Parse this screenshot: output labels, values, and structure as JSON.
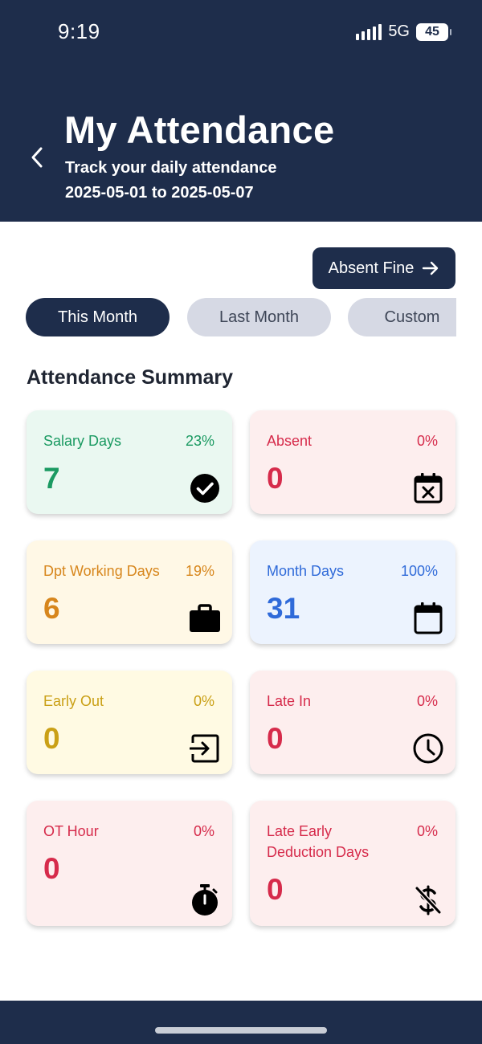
{
  "status_bar": {
    "time": "9:19",
    "network": "5G",
    "battery": "45"
  },
  "header": {
    "title": "My Attendance",
    "subtitle": "Track your daily attendance",
    "date_range": "2025-05-01 to 2025-05-07"
  },
  "actions": {
    "absent_fine": "Absent Fine"
  },
  "tabs": [
    {
      "label": "This Month",
      "active": true
    },
    {
      "label": "Last Month",
      "active": false
    },
    {
      "label": "Custom",
      "active": false
    }
  ],
  "summary": {
    "title": "Attendance Summary",
    "cards": [
      {
        "label": "Salary Days",
        "value": "7",
        "percent": "23%",
        "icon": "check-circle-icon",
        "bg": "#eaf8f1",
        "color": "#1b9a62"
      },
      {
        "label": "Absent",
        "value": "0",
        "percent": "0%",
        "icon": "calendar-x-icon",
        "bg": "#fdeeee",
        "color": "#d62b4b"
      },
      {
        "label": "Dpt Working Days",
        "value": "6",
        "percent": "19%",
        "icon": "briefcase-icon",
        "bg": "#fff8e6",
        "color": "#d7861c"
      },
      {
        "label": "Month Days",
        "value": "31",
        "percent": "100%",
        "icon": "calendar-icon",
        "bg": "#ecf3fe",
        "color": "#2f6ad9"
      },
      {
        "label": "Early Out",
        "value": "0",
        "percent": "0%",
        "icon": "exit-icon",
        "bg": "#fffae3",
        "color": "#caa016"
      },
      {
        "label": "Late In",
        "value": "0",
        "percent": "0%",
        "icon": "clock-icon",
        "bg": "#fdeeee",
        "color": "#d62b4b"
      },
      {
        "label": "OT Hour",
        "value": "0",
        "percent": "0%",
        "icon": "stopwatch-icon",
        "bg": "#fdeeee",
        "color": "#d62b4b"
      },
      {
        "label": "Late Early Deduction Days",
        "value": "0",
        "percent": "0%",
        "icon": "dollar-off-icon",
        "bg": "#fdeeee",
        "color": "#d62b4b"
      }
    ]
  }
}
